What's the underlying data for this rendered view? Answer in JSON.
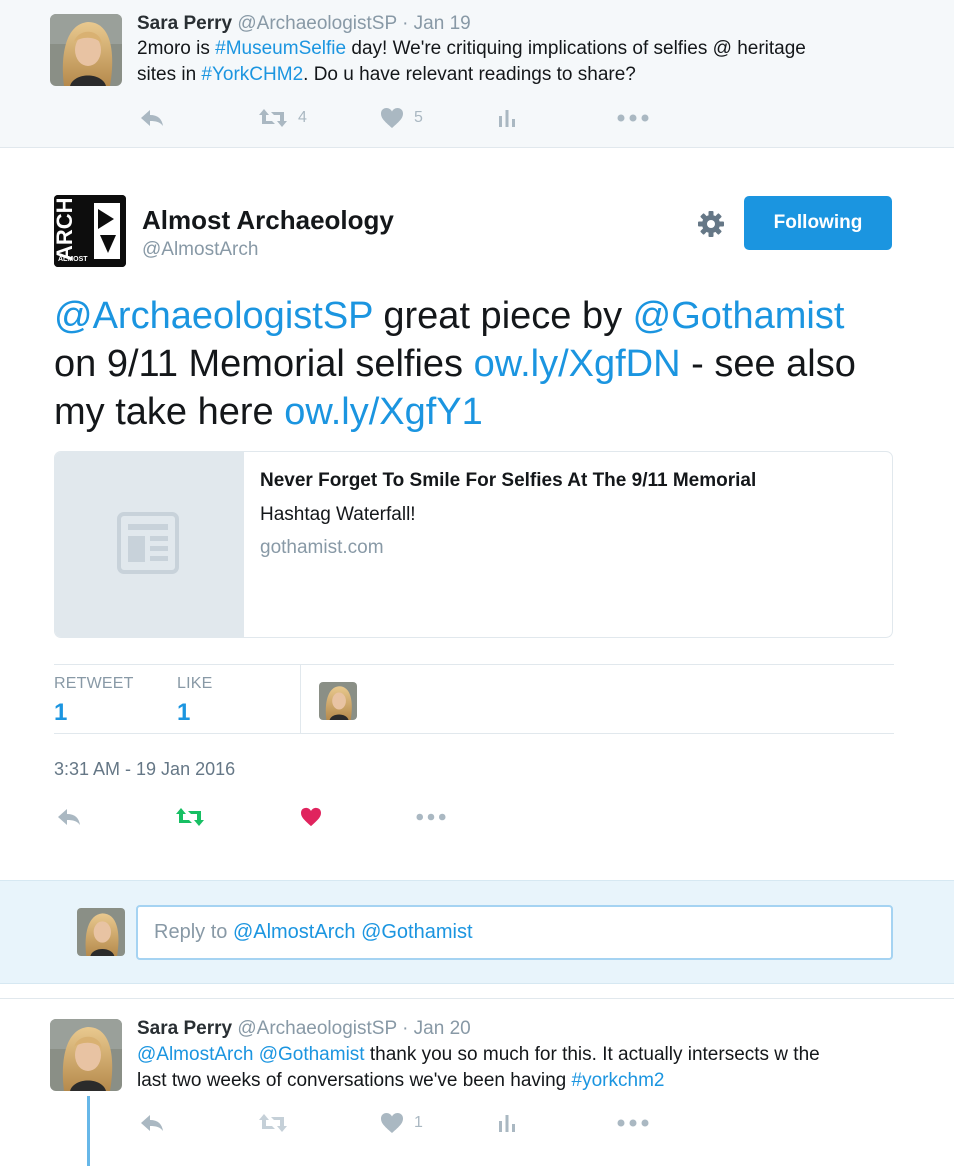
{
  "parent_tweet": {
    "name": "Sara Perry",
    "handle": "@ArchaeologistSP",
    "date": "· Jan 19",
    "text_line1_a": "2moro is ",
    "text_line1_hashtag": "#MuseumSelfie",
    "text_line1_b": " day! We're critiquing implications of selfies @ heritage",
    "text_line2_a": "sites in ",
    "text_line2_hashtag": "#YorkCHM2",
    "text_line2_b": ". Do u have relevant readings to share?",
    "retweet_count": "4",
    "like_count": "5"
  },
  "main_tweet": {
    "name": "Almost Archaeology",
    "handle": "@AlmostArch",
    "logo_text": "ARCH",
    "logo_small": "ALMOST",
    "follow_label": "Following",
    "line1_mention1": "@ArchaeologistSP",
    "line1_mid": " great piece by ",
    "line1_mention2": "@Gothamist",
    "line2_a": "on 9/11 Memorial selfies ",
    "line2_link": "ow.ly/XgfDN",
    "line2_b": " - see also",
    "line3_a": "my take here ",
    "line3_link": "ow.ly/XgfY1",
    "card": {
      "title": "Never Forget To Smile For Selfies At The 9/11 Memorial",
      "description": "Hashtag Waterfall!",
      "domain": "gothamist.com"
    },
    "stats": {
      "retweet_label": "RETWEET",
      "retweet_value": "1",
      "like_label": "LIKE",
      "like_value": "1"
    },
    "timestamp": "3:31 AM - 19 Jan 2016"
  },
  "reply_box": {
    "prefix": "Reply to ",
    "mention1": "@AlmostArch",
    "mention2": "@Gothamist"
  },
  "reply_tweet": {
    "name": "Sara Perry",
    "handle": "@ArchaeologistSP",
    "date": "· Jan 20",
    "mention1": "@AlmostArch",
    "mention2": "@Gothamist",
    "text_line1": " thank you so much for this. It actually intersects w the",
    "text_line2": "last two weeks of conversations we've been having ",
    "hashtag": "#yorkchm2",
    "like_count": "1"
  },
  "colors": {
    "link": "#1b95e0",
    "retweeted": "#17bf63",
    "liked": "#e0245e",
    "icon_gray": "#aab8c2"
  }
}
